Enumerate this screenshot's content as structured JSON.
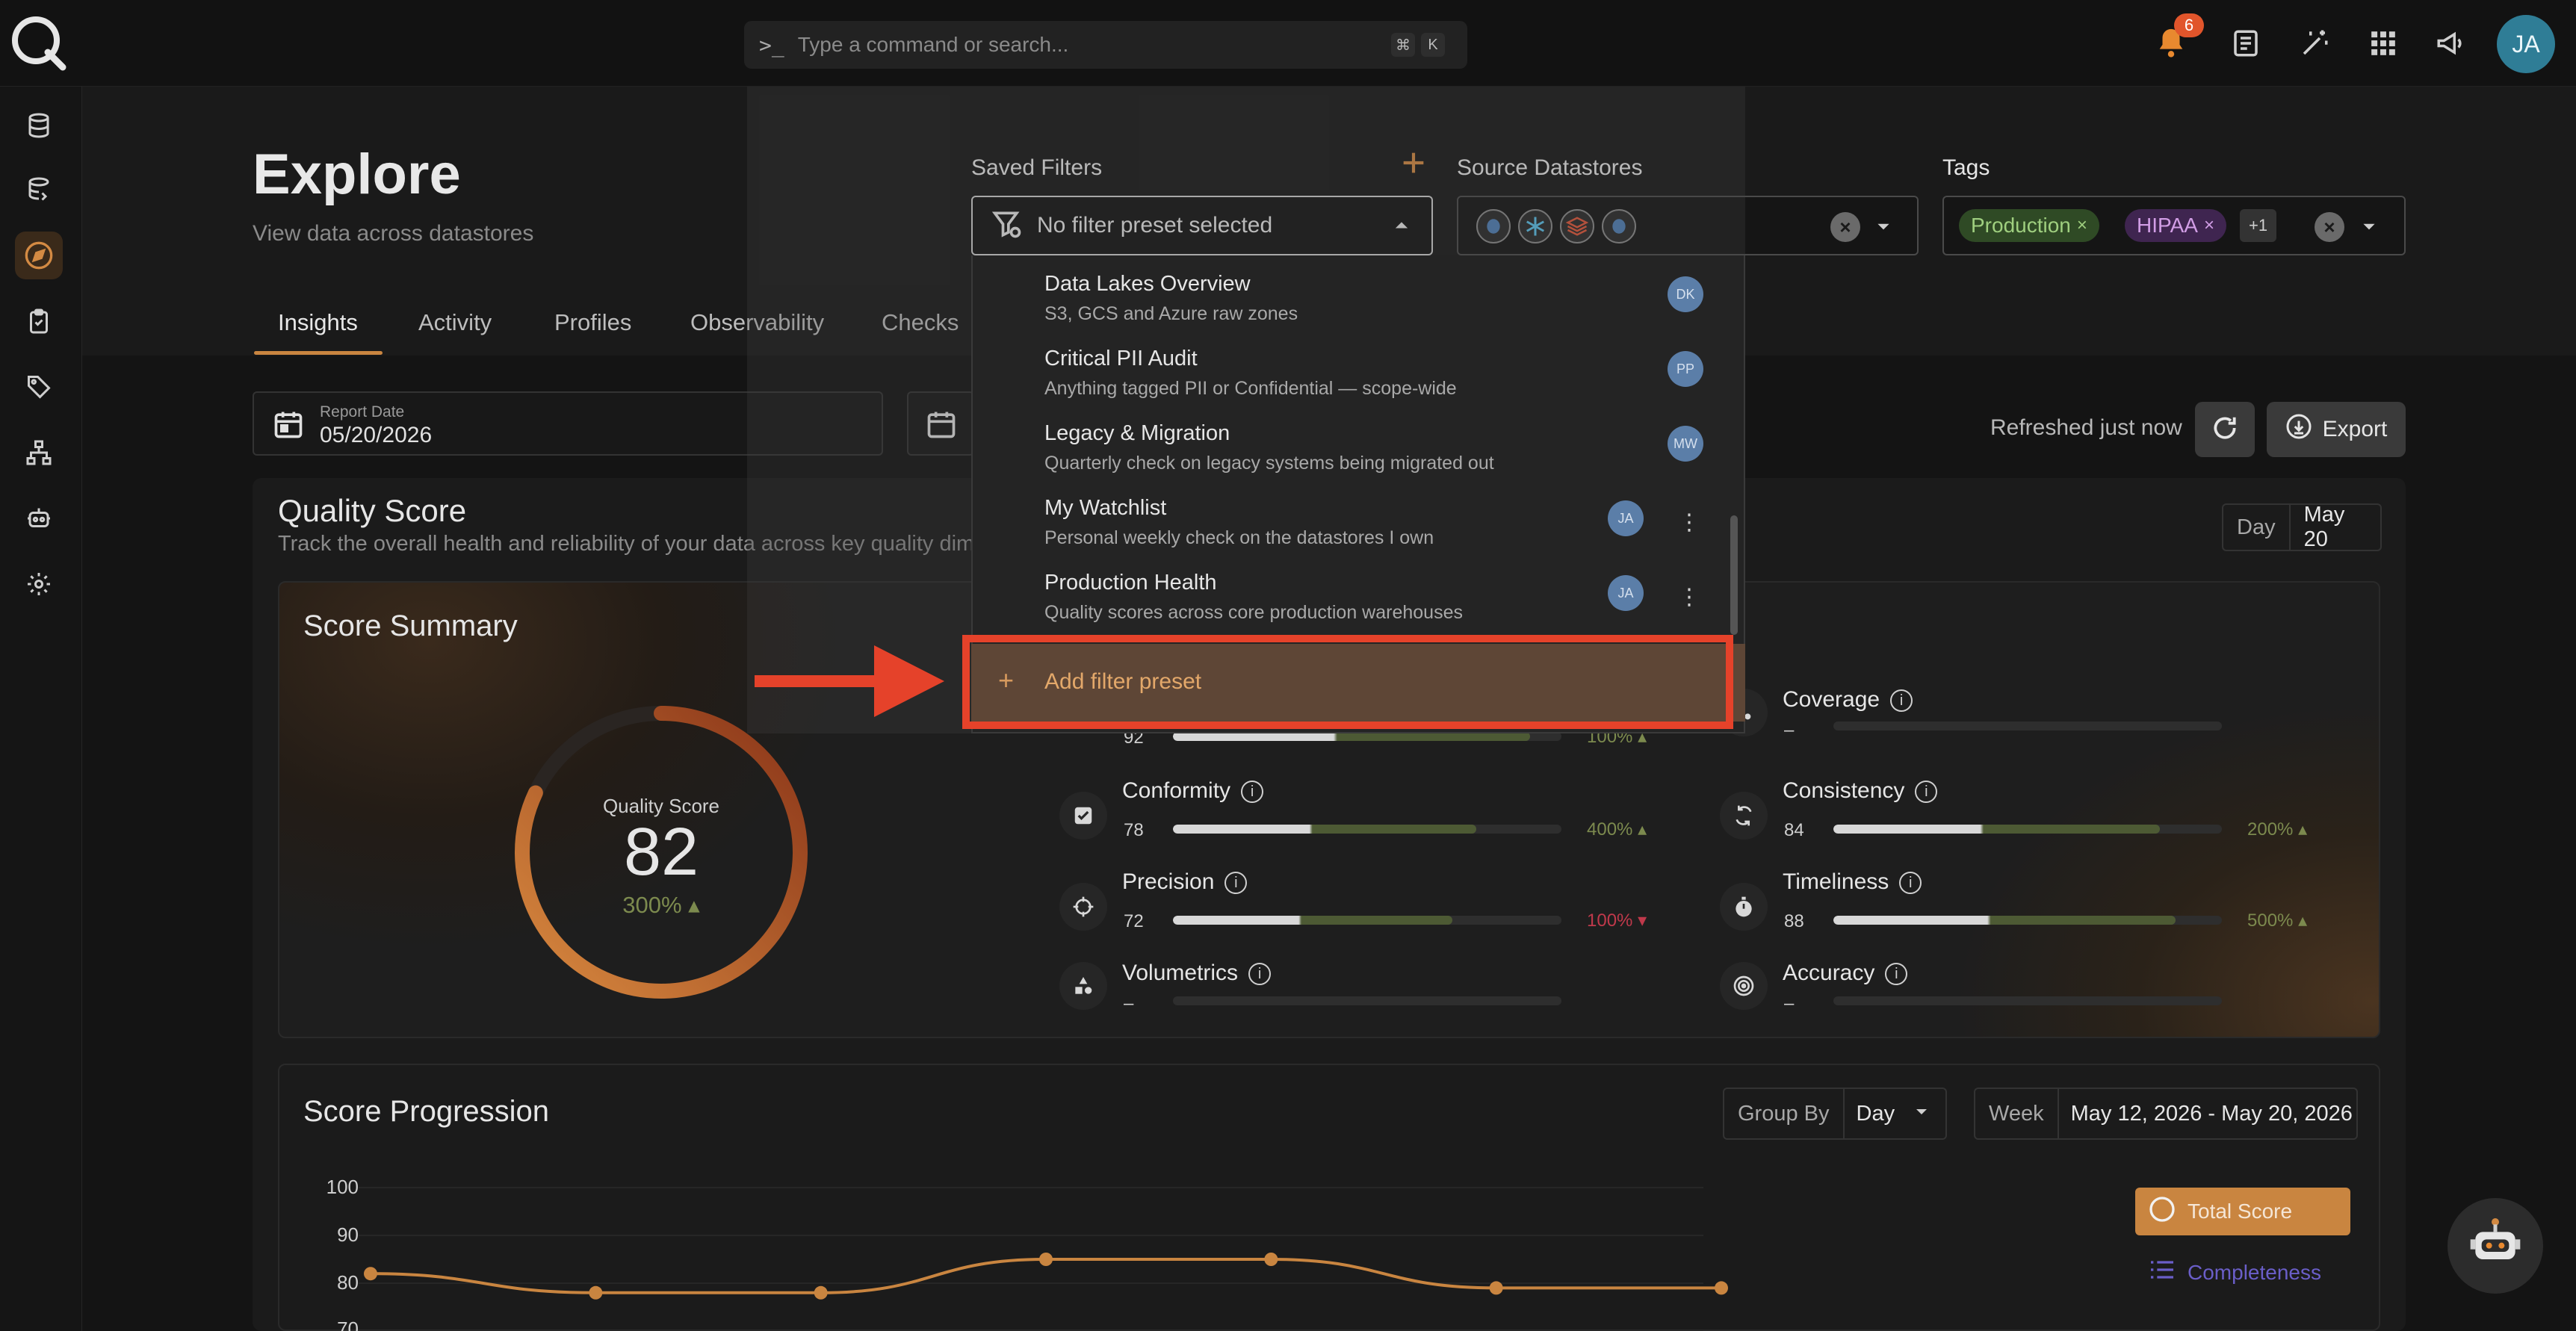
{
  "topbar": {
    "search_placeholder": "Type a command or search...",
    "shortcut_mod": "⌘",
    "shortcut_key": "K",
    "notification_count": "6",
    "user_initials": "JA"
  },
  "page": {
    "title": "Explore",
    "subtitle": "View data across datastores"
  },
  "tabs": [
    {
      "label": "Insights",
      "active": true
    },
    {
      "label": "Activity"
    },
    {
      "label": "Profiles"
    },
    {
      "label": "Observability"
    },
    {
      "label": "Checks"
    }
  ],
  "filters": {
    "saved_label": "Saved Filters",
    "saved_value": "No filter preset selected",
    "source_label": "Source Datastores",
    "tags_label": "Tags",
    "tags": [
      {
        "label": "Production",
        "color": "#3a5a2a",
        "text": "#9fcf7f"
      },
      {
        "label": "HIPAA",
        "color": "#4a2a5a",
        "text": "#cf9fdf"
      }
    ],
    "tags_more": "+1"
  },
  "saved_presets": {
    "items": [
      {
        "title": "Data Lakes Overview",
        "desc": "S3, GCS and Azure raw zones",
        "owner": "DK",
        "menu": false
      },
      {
        "title": "Critical PII Audit",
        "desc": "Anything tagged PII or Confidential — scope-wide",
        "owner": "PP",
        "menu": false
      },
      {
        "title": "Legacy & Migration",
        "desc": "Quarterly check on legacy systems being migrated out",
        "owner": "MW",
        "menu": false
      },
      {
        "title": "My Watchlist",
        "desc": "Personal weekly check on the datastores I own",
        "owner": "JA",
        "menu": true
      },
      {
        "title": "Production Health",
        "desc": "Quality scores across core production warehouses",
        "owner": "JA",
        "menu": true
      }
    ],
    "add_label": "Add filter preset"
  },
  "date": {
    "label": "Report Date",
    "value": "05/20/2026"
  },
  "actions": {
    "refreshed": "Refreshed just now",
    "export": "Export"
  },
  "quality": {
    "title": "Quality Score",
    "subtitle": "Track the overall health and reliability of your data across key quality dime",
    "period_label": "Day",
    "period_value": "May 20",
    "summary_title": "Score Summary",
    "gauge_label": "Quality Score",
    "gauge_value": "82",
    "gauge_fraction": 0.82,
    "gauge_delta": "300%",
    "metrics_left": [
      {
        "name": "",
        "value": "92",
        "delta": "100%",
        "dir": "up",
        "fraction": 0.92
      },
      {
        "name": "Conformity",
        "value": "78",
        "delta": "400%",
        "dir": "up",
        "fraction": 0.78
      },
      {
        "name": "Precision",
        "value": "72",
        "delta": "100%",
        "dir": "down",
        "fraction": 0.72
      },
      {
        "name": "Volumetrics",
        "value": "–",
        "delta": "",
        "dir": "",
        "fraction": 0
      }
    ],
    "metrics_right": [
      {
        "name": "Coverage",
        "value": "–",
        "delta": "",
        "dir": "",
        "fraction": 0
      },
      {
        "name": "Consistency",
        "value": "84",
        "delta": "200%",
        "dir": "up",
        "fraction": 0.84
      },
      {
        "name": "Timeliness",
        "value": "88",
        "delta": "500%",
        "dir": "up",
        "fraction": 0.88
      },
      {
        "name": "Accuracy",
        "value": "–",
        "delta": "",
        "dir": "",
        "fraction": 0
      }
    ]
  },
  "progression": {
    "title": "Score Progression",
    "group_by_label": "Group By",
    "group_by_value": "Day",
    "range_label": "Week",
    "range_value": "May 12, 2026 - May 20, 2026",
    "legend_total": "Total Score",
    "legend_completeness": "Completeness",
    "y_ticks": [
      "100",
      "90",
      "80",
      "70"
    ]
  },
  "colors": {
    "accent": "#c98540",
    "positive": "#7c8a4e",
    "negative": "#c0394b",
    "highlight": "#e5422a"
  },
  "chart_data": {
    "type": "line",
    "ylim": [
      70,
      100
    ],
    "series": [
      {
        "name": "Total Score",
        "values": [
          82,
          78,
          78,
          85,
          85,
          79,
          79
        ]
      }
    ]
  }
}
